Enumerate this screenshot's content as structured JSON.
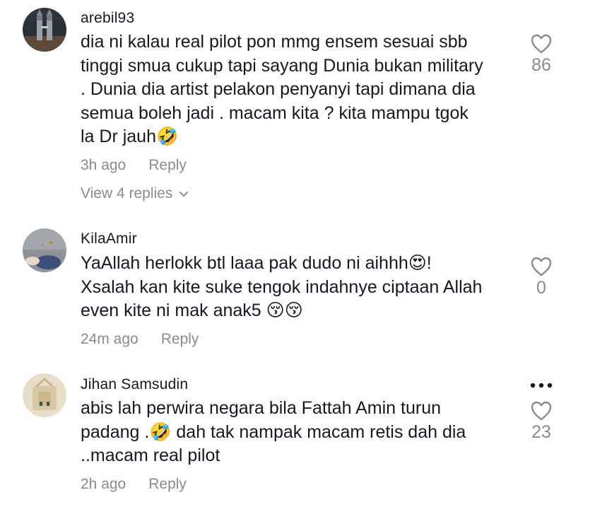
{
  "comments": [
    {
      "username": "arebil93",
      "text": "dia ni kalau real pilot pon mmg ensem sesuai sbb\ntinggi smua cukup tapi sayang Dunia bukan military\n. Dunia dia artist pelakon penyanyi tapi dimana dia\nsemua boleh jadi . macam kita ? kita mampu tgok\nla Dr jauh🤣",
      "time": "3h ago",
      "reply_label": "Reply",
      "like_count": "86",
      "view_replies": "View 4 replies"
    },
    {
      "username": "KilaAmir",
      "text": "YaAllah herlokk btl laaa pak dudo ni aihhh😍!\nXsalah kan kite suke tengok indahnye ciptaan Allah\neven kite ni mak anak5 😚😚",
      "time": "24m ago",
      "reply_label": "Reply",
      "like_count": "0"
    },
    {
      "username": "Jihan Samsudin",
      "text": "abis lah perwira negara bila Fattah Amin turun\npadang .🤣 dah tak nampak macam retis dah dia\n..macam real pilot",
      "time": "2h ago",
      "reply_label": "Reply",
      "like_count": "23"
    }
  ],
  "icons": {
    "heart": "heart-outline-icon",
    "more": "more-horizontal-icon",
    "chevron": "chevron-down-icon"
  },
  "colors": {
    "text": "#161823",
    "muted": "#8a8b91"
  }
}
